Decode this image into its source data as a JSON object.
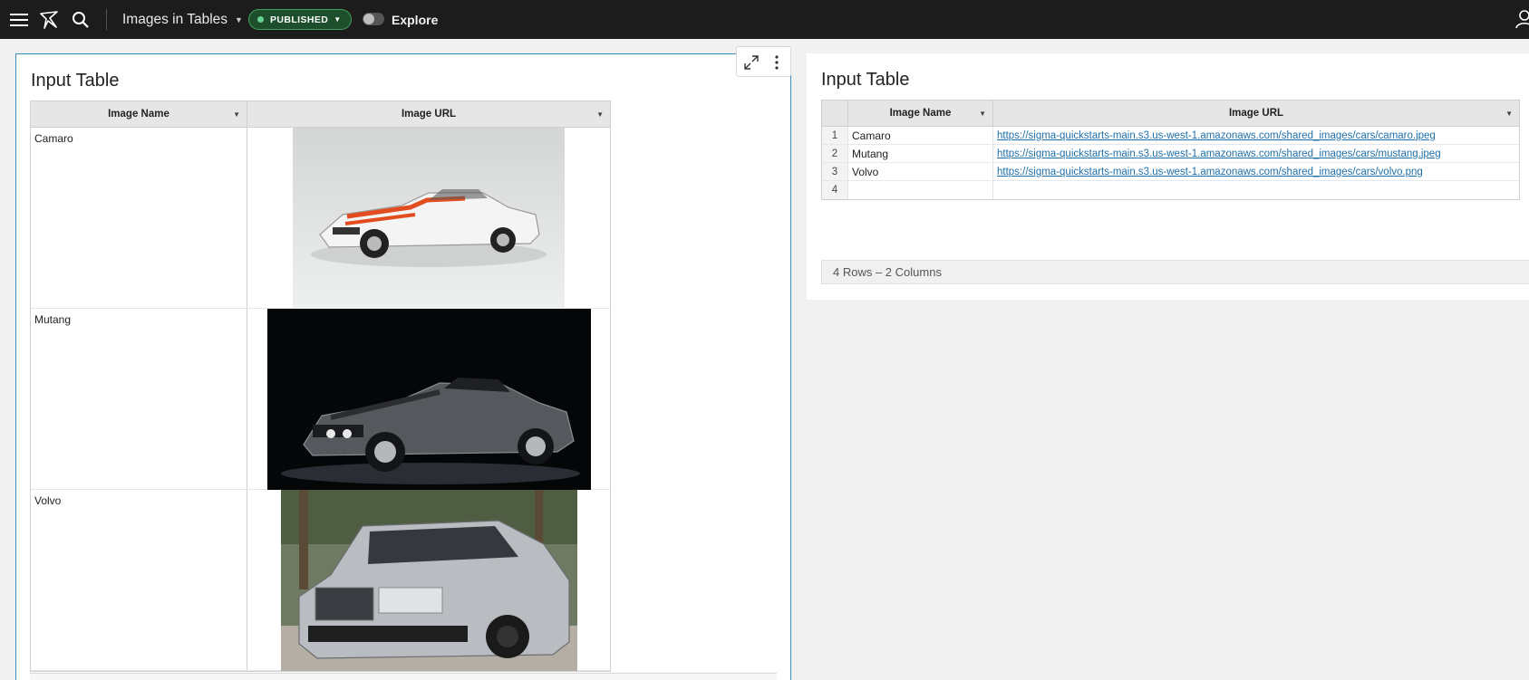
{
  "header": {
    "workbook_title": "Images in Tables",
    "status_badge": "PUBLISHED",
    "explore_label": "Explore"
  },
  "left_panel": {
    "title": "Input Table",
    "columns": [
      "Image Name",
      "Image URL"
    ],
    "rows": [
      {
        "name": "Camaro",
        "image": "camaro-car-image"
      },
      {
        "name": "Mutang",
        "image": "mustang-car-image"
      },
      {
        "name": "Volvo",
        "image": "volvo-car-image"
      }
    ]
  },
  "right_panel": {
    "title": "Input Table",
    "columns": [
      "Image Name",
      "Image URL"
    ],
    "rows": [
      {
        "num": "1",
        "name": "Camaro",
        "url": "https://sigma-quickstarts-main.s3.us-west-1.amazonaws.com/shared_images/cars/camaro.jpeg"
      },
      {
        "num": "2",
        "name": "Mutang",
        "url": "https://sigma-quickstarts-main.s3.us-west-1.amazonaws.com/shared_images/cars/mustang.jpeg"
      },
      {
        "num": "3",
        "name": "Volvo",
        "url": "https://sigma-quickstarts-main.s3.us-west-1.amazonaws.com/shared_images/cars/volvo.png"
      },
      {
        "num": "4",
        "name": "",
        "url": ""
      }
    ],
    "footer": "4 Rows – 2 Columns"
  },
  "colors": {
    "topbar": "#1c1c1c",
    "badge_green": "#68d391",
    "link": "#1f6fa8",
    "selected_border": "#3a8fbf"
  }
}
